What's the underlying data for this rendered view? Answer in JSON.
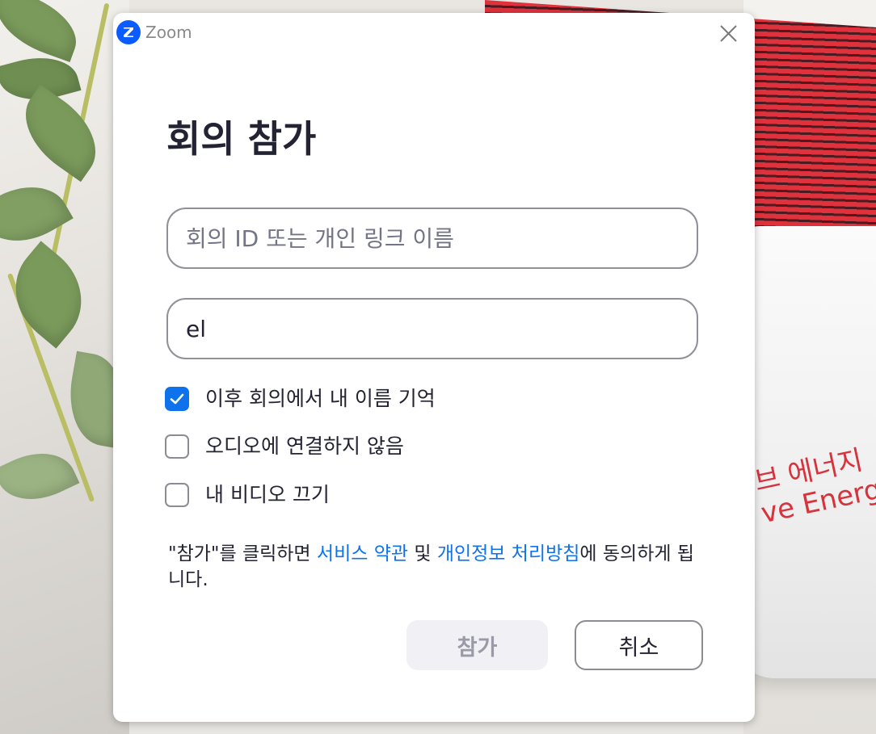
{
  "app": {
    "name": "Zoom",
    "logo_letter": "Z",
    "brand_color": "#0b5cff"
  },
  "dialog": {
    "title": "회의 참가",
    "meeting_id": {
      "placeholder": "회의 ID 또는 개인 링크 이름",
      "value": ""
    },
    "display_name": {
      "value": "el"
    },
    "options": [
      {
        "label": "이후 회의에서 내 이름 기억",
        "checked": true
      },
      {
        "label": "오디오에 연결하지 않음",
        "checked": false
      },
      {
        "label": "내 비디오 끄기",
        "checked": false
      }
    ],
    "terms": {
      "prefix": "\"참가\"를 클릭하면 ",
      "tos_link": "서비스 약관",
      "middle": " 및 ",
      "privacy_link": "개인정보 처리방침",
      "suffix": "에 동의하게 됩니다."
    },
    "buttons": {
      "join": "참가",
      "cancel": "취소"
    }
  },
  "background": {
    "pack_line1": "브 에너지",
    "pack_line2": "ve Energy",
    "accent_color": "#0e72ed"
  },
  "icons": {
    "close": "close-icon",
    "check": "checkmark-icon",
    "logo": "zoom-logo-icon"
  }
}
